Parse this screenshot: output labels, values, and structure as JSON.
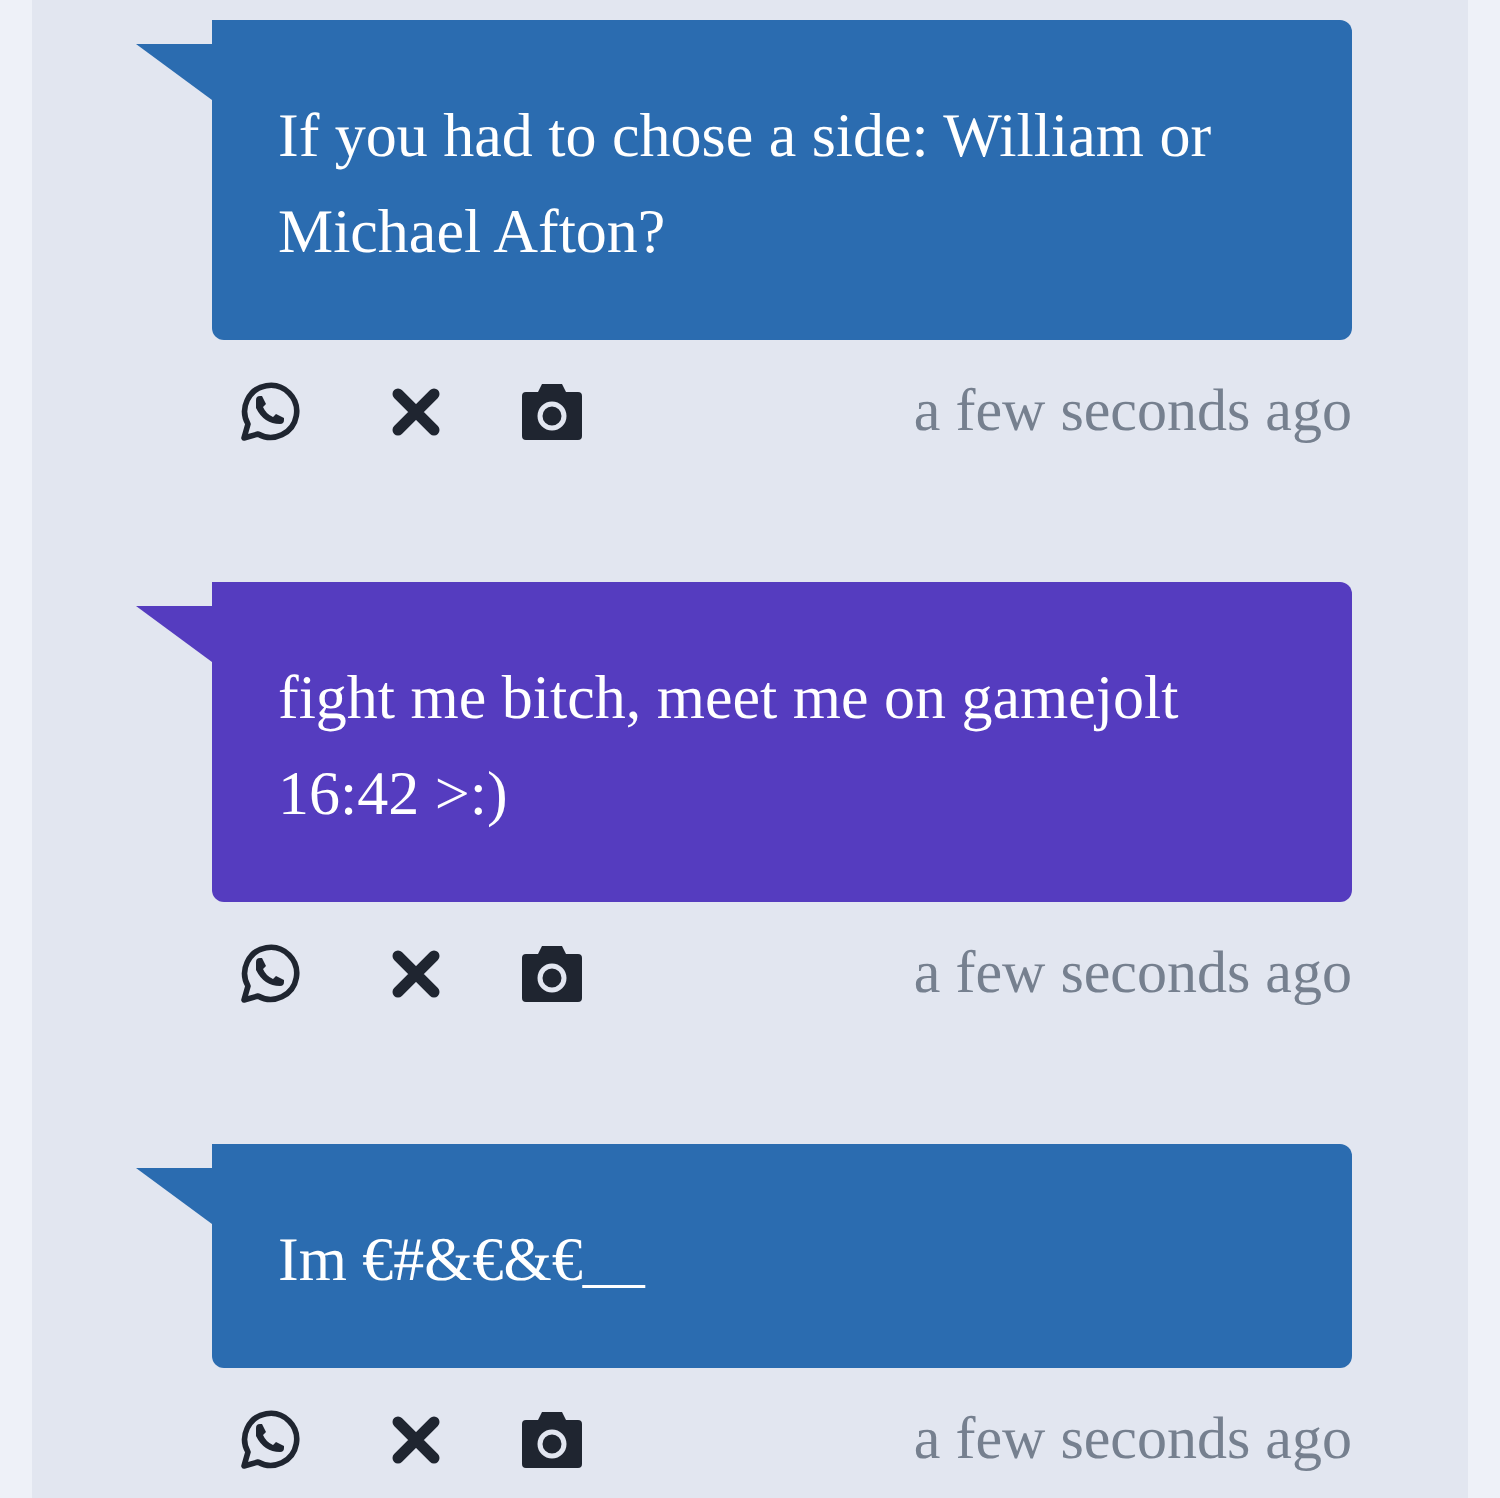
{
  "messages": [
    {
      "text": "If you had to chose a side: William or Michael Afton?",
      "color": "#2b6cb0",
      "time": "a few seconds ago"
    },
    {
      "text": "fight me bitch, meet me on gamejolt 16:42 >:)",
      "color": "#553cbf",
      "time": "a few seconds ago"
    },
    {
      "text": "Im €#&€&€__",
      "color": "#2b6cb0",
      "time": "a few seconds ago"
    }
  ]
}
